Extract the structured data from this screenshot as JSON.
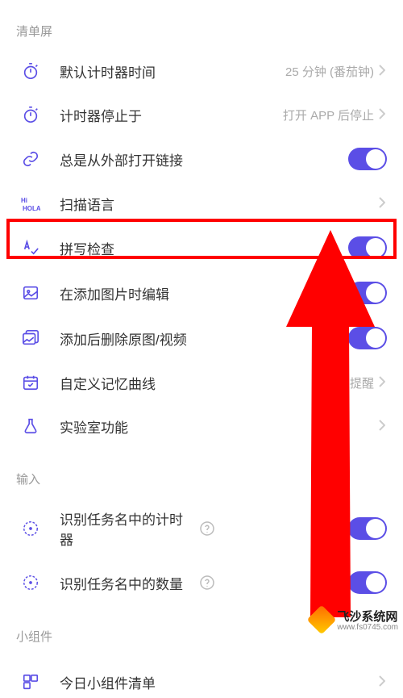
{
  "accent": "#5b4ee6",
  "sections": {
    "qingdan": {
      "title": "清单屏"
    },
    "input": {
      "title": "输入"
    },
    "widget": {
      "title": "小组件"
    }
  },
  "rows": {
    "timer_default": {
      "label": "默认计时器时间",
      "value": "25 分钟 (番茄钟)"
    },
    "timer_stop": {
      "label": "计时器停止于",
      "value": "打开 APP 后停止"
    },
    "ext_link": {
      "label": "总是从外部打开链接"
    },
    "scan_lang": {
      "label": "扫描语言"
    },
    "spellcheck": {
      "label": "拼写检查"
    },
    "edit_img": {
      "label": "在添加图片时编辑"
    },
    "del_orig": {
      "label": "添加后删除原图/视频"
    },
    "memory_curve": {
      "label": "自定义记忆曲线",
      "value": "8 次提醒"
    },
    "lab": {
      "label": "实验室功能"
    },
    "rec_timer": {
      "label": "识别任务名中的计时器"
    },
    "rec_qty": {
      "label": "识别任务名中的数量"
    },
    "today_widget": {
      "label": "今日小组件清单"
    }
  },
  "watermark": {
    "name": "飞沙系统网",
    "url": "www.fs0745.com"
  }
}
